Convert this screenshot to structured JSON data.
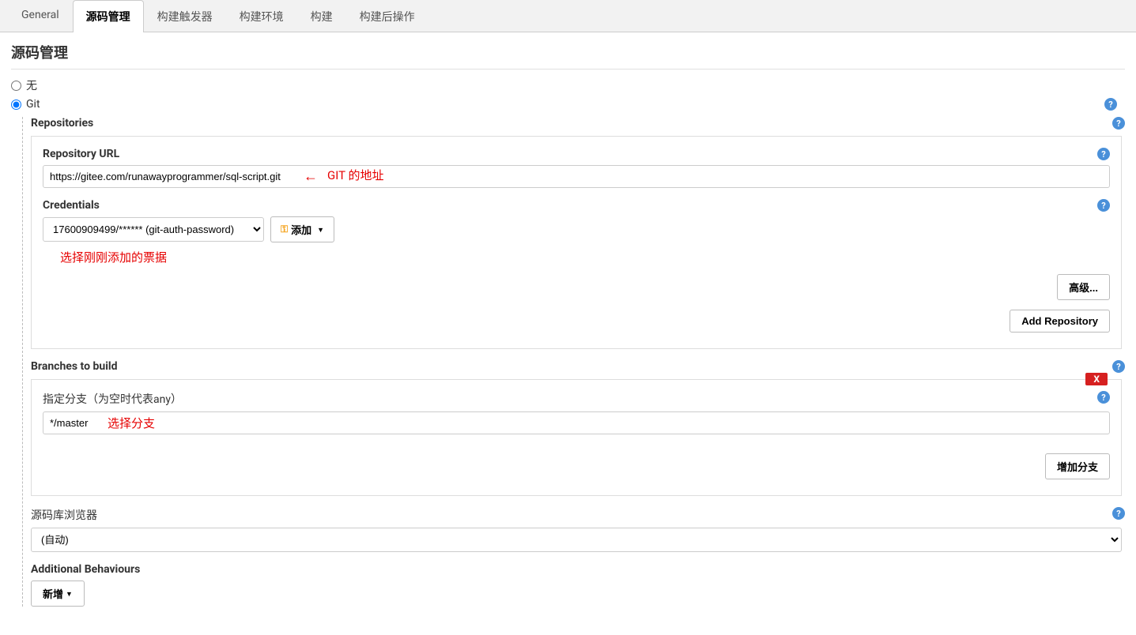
{
  "tabs": {
    "general": "General",
    "scm": "源码管理",
    "triggers": "构建触发器",
    "env": "构建环境",
    "build": "构建",
    "postbuild": "构建后操作"
  },
  "section": {
    "title": "源码管理"
  },
  "scm": {
    "none_label": "无",
    "git_label": "Git"
  },
  "repositories": {
    "label": "Repositories",
    "url_label": "Repository URL",
    "url_value": "https://gitee.com/runawayprogrammer/sql-script.git",
    "annotation_git": "GIT 的地址",
    "credentials_label": "Credentials",
    "credentials_value": "17600909499/****** (git-auth-password)",
    "add_button": "添加",
    "annotation_cred": "选择刚刚添加的票据",
    "advanced_button": "高级...",
    "add_repo_button": "Add Repository"
  },
  "branches": {
    "label": "Branches to build",
    "specifier_label": "指定分支（为空时代表any）",
    "value": "*/master",
    "annotation": "选择分支",
    "delete": "X",
    "add_branch_button": "增加分支"
  },
  "browser": {
    "label": "源码库浏览器",
    "value": "(自动)"
  },
  "additional": {
    "label": "Additional Behaviours",
    "new_button": "新增"
  },
  "help": "?"
}
